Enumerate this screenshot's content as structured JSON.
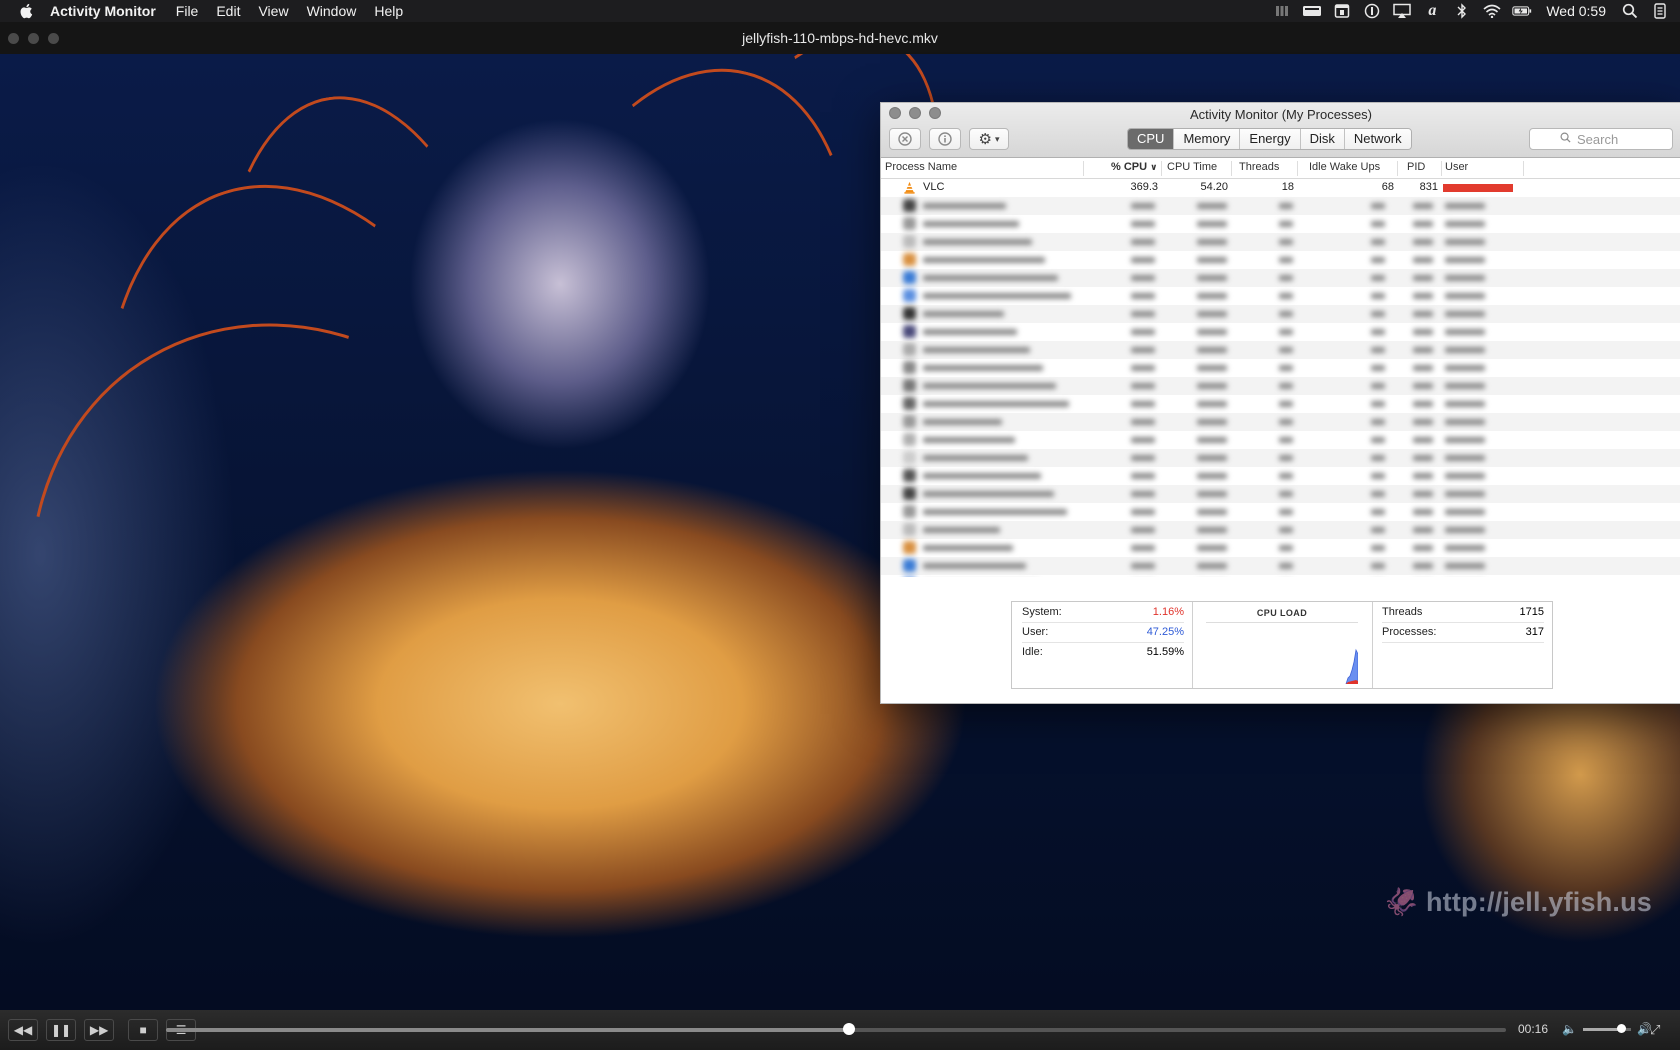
{
  "menubar": {
    "app_name": "Activity Monitor",
    "menus": [
      "File",
      "Edit",
      "View",
      "Window",
      "Help"
    ],
    "clock": "Wed 0:59",
    "status_icons": [
      "stack-icon",
      "menubar-app-icon",
      "calendar-icon",
      "info-icon",
      "airplay-icon",
      "dictionary-icon",
      "bluetooth-icon",
      "wifi-icon",
      "battery-icon",
      "search-icon",
      "notification-icon"
    ]
  },
  "vlc": {
    "window_title": "jellyfish-110-mbps-hd-hevc.mkv",
    "watermark": "http://jell.yfish.us",
    "time_elapsed": "00:16",
    "progress": 0.51,
    "volume": 0.8
  },
  "activity_monitor": {
    "title": "Activity Monitor (My Processes)",
    "tabs": [
      "CPU",
      "Memory",
      "Energy",
      "Disk",
      "Network"
    ],
    "active_tab": "CPU",
    "search_placeholder": "Search",
    "columns": [
      "Process Name",
      "% CPU",
      "CPU Time",
      "Threads",
      "Idle Wake Ups",
      "PID",
      "User"
    ],
    "processes": [
      {
        "name": "VLC",
        "cpu": "369.3",
        "cpu_time": "54.20",
        "threads": "18",
        "idle_wake_ups": "68",
        "pid": "831",
        "user_redacted": true
      }
    ],
    "summary": {
      "system_label": "System:",
      "system_value": "1.16%",
      "user_label": "User:",
      "user_value": "47.25%",
      "idle_label": "Idle:",
      "idle_value": "51.59%",
      "cpu_load_title": "CPU LOAD",
      "threads_label": "Threads",
      "threads_value": "1715",
      "processes_label": "Processes:",
      "processes_value": "317"
    },
    "colors": {
      "system": "#e0332b",
      "user": "#2f5bd6",
      "redaction": "#e23b2e"
    }
  }
}
